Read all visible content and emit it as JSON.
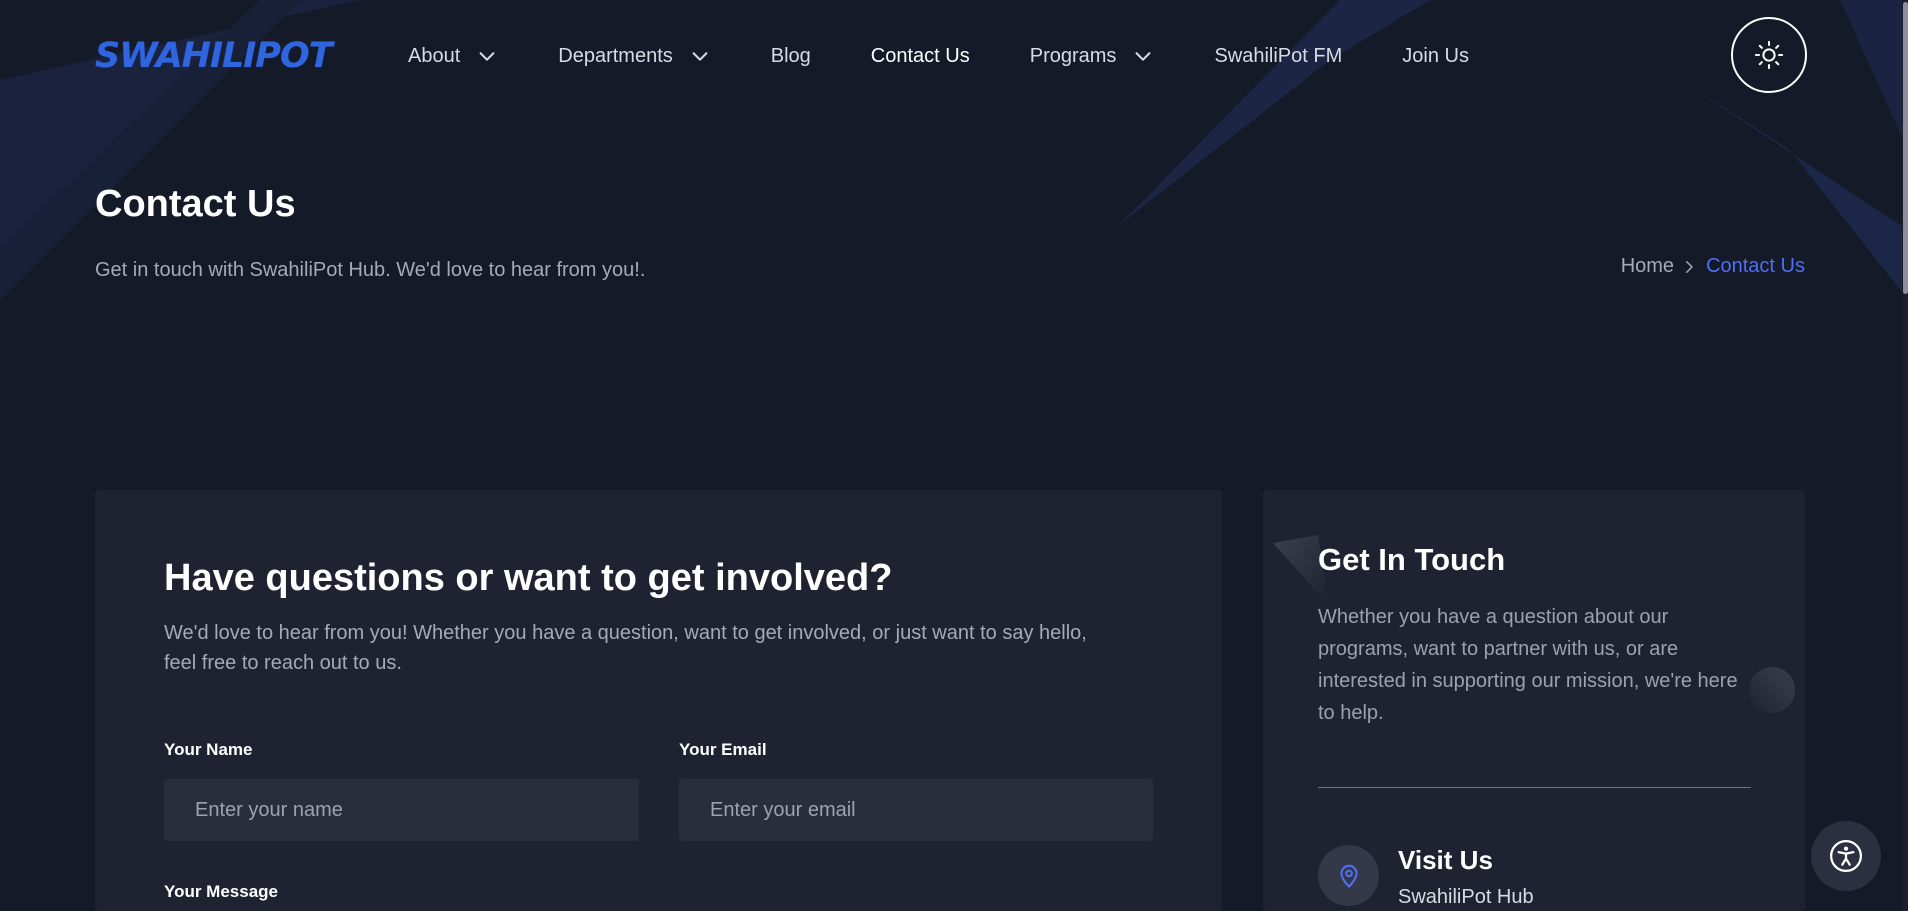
{
  "header": {
    "logo_text": "SWAHILIPOT",
    "nav": [
      {
        "label": "About",
        "has_dropdown": true,
        "active": false
      },
      {
        "label": "Departments",
        "has_dropdown": true,
        "active": false
      },
      {
        "label": "Blog",
        "has_dropdown": false,
        "active": false
      },
      {
        "label": "Contact Us",
        "has_dropdown": false,
        "active": true
      },
      {
        "label": "Programs",
        "has_dropdown": true,
        "active": false
      },
      {
        "label": "SwahiliPot FM",
        "has_dropdown": false,
        "active": false
      },
      {
        "label": "Join Us",
        "has_dropdown": false,
        "active": false
      }
    ],
    "theme_toggle_icon": "sun-icon"
  },
  "hero": {
    "title": "Contact Us",
    "subtitle": "Get in touch with SwahiliPot Hub. We'd love to hear from you!.",
    "breadcrumb": {
      "home": "Home",
      "current": "Contact Us"
    }
  },
  "form": {
    "heading": "Have questions or want to get involved?",
    "intro": "We'd love to hear from you! Whether you have a question, want to get involved, or just want to say hello, feel free to reach out to us.",
    "name_label": "Your Name",
    "name_placeholder": "Enter your name",
    "email_label": "Your Email",
    "email_placeholder": "Enter your email",
    "message_label": "Your Message"
  },
  "contact": {
    "heading": "Get In Touch",
    "text": "Whether you have a question about our programs, want to partner with us, or are interested in supporting our mission, we're here to help.",
    "visit_title": "Visit Us",
    "visit_line": "SwahiliPot Hub"
  },
  "colors": {
    "background": "#151a28",
    "card": "#1f2331",
    "accent": "#4f6ff6",
    "logo_blue": "#2f66e0"
  }
}
